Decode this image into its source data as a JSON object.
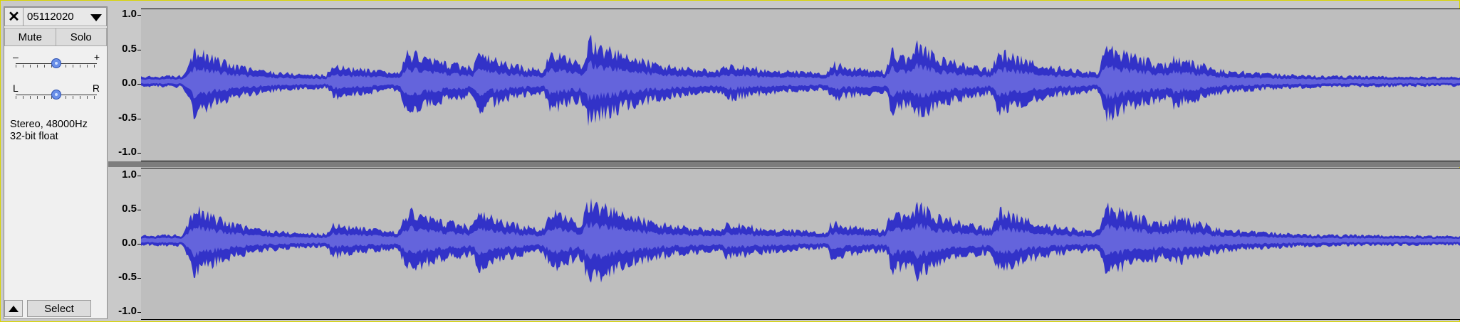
{
  "track": {
    "close_icon": "close-icon",
    "name": "05112020",
    "menu_icon": "chevron-down-icon",
    "mute_label": "Mute",
    "solo_label": "Solo",
    "gain": {
      "min_label": "–",
      "max_label": "+",
      "value": 0.5
    },
    "pan": {
      "left_label": "L",
      "right_label": "R",
      "value": 0.5
    },
    "info_line1": "Stereo, 48000Hz",
    "info_line2": "32-bit float",
    "collapse_icon": "collapse-up-icon",
    "select_label": "Select"
  },
  "ruler": {
    "labels": [
      "1.0",
      "0.5",
      "0.0",
      "-0.5",
      "-1.0"
    ]
  },
  "waveform": {
    "color_peak": "#3232c8",
    "color_rms": "#6464dc",
    "background": "#bebebe"
  }
}
